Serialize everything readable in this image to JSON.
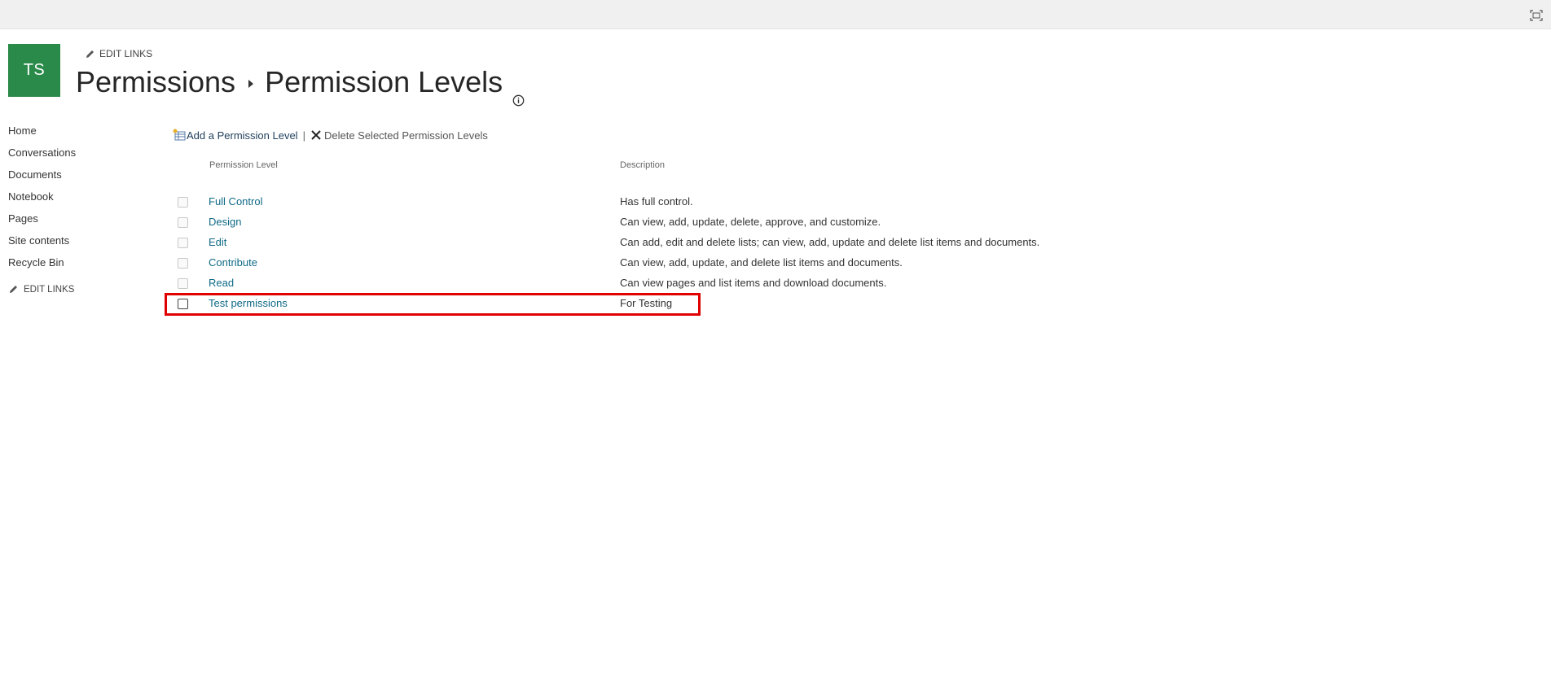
{
  "header": {
    "logo_initials": "TS",
    "edit_links_label": "EDIT LINKS",
    "breadcrumb_parent": "Permissions",
    "page_title": "Permission Levels"
  },
  "nav": {
    "items": [
      "Home",
      "Conversations",
      "Documents",
      "Notebook",
      "Pages",
      "Site contents",
      "Recycle Bin"
    ],
    "edit_links_label": "EDIT LINKS"
  },
  "toolbar": {
    "add_label": "Add a Permission Level",
    "separator": "|",
    "delete_label": "Delete Selected Permission Levels"
  },
  "table": {
    "col_level": "Permission Level",
    "col_description": "Description",
    "rows": [
      {
        "name": "Full Control",
        "description": "Has full control."
      },
      {
        "name": "Design",
        "description": "Can view, add, update, delete, approve, and customize."
      },
      {
        "name": "Edit",
        "description": "Can add, edit and delete lists; can view, add, update and delete list items and documents."
      },
      {
        "name": "Contribute",
        "description": "Can view, add, update, and delete list items and documents."
      },
      {
        "name": "Read",
        "description": "Can view pages and list items and download documents."
      },
      {
        "name": "Test permissions",
        "description": "For Testing"
      }
    ]
  },
  "colors": {
    "logo_bg": "#2a8a4a",
    "link": "#0f6a86",
    "highlight": "#e00000"
  }
}
